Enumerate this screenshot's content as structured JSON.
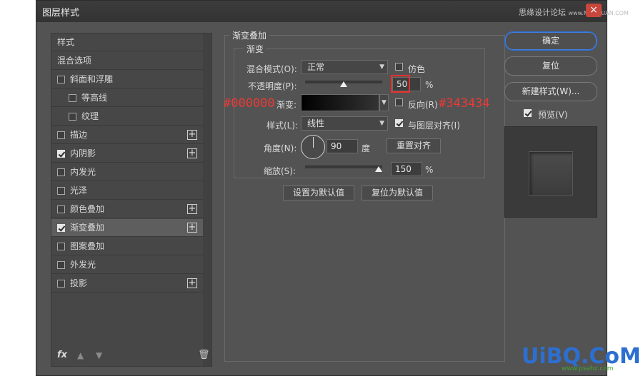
{
  "window": {
    "title": "图层样式",
    "close_label": "×",
    "watermark_text": "思缘设计论坛",
    "watermark_url": "www.MISSYUAN.COM"
  },
  "style_list": {
    "items": [
      {
        "label": "样式",
        "checkbox": null,
        "plus": false,
        "indent": 0,
        "selected": false
      },
      {
        "label": "混合选项",
        "checkbox": null,
        "plus": false,
        "indent": 0,
        "selected": false
      },
      {
        "label": "斜面和浮雕",
        "checkbox": false,
        "plus": false,
        "indent": 0,
        "selected": false
      },
      {
        "label": "等高线",
        "checkbox": false,
        "plus": false,
        "indent": 1,
        "selected": false
      },
      {
        "label": "纹理",
        "checkbox": false,
        "plus": false,
        "indent": 1,
        "selected": false
      },
      {
        "label": "描边",
        "checkbox": false,
        "plus": true,
        "indent": 0,
        "selected": false
      },
      {
        "label": "内阴影",
        "checkbox": true,
        "plus": true,
        "indent": 0,
        "selected": false
      },
      {
        "label": "内发光",
        "checkbox": false,
        "plus": false,
        "indent": 0,
        "selected": false
      },
      {
        "label": "光泽",
        "checkbox": false,
        "plus": false,
        "indent": 0,
        "selected": false
      },
      {
        "label": "颜色叠加",
        "checkbox": false,
        "plus": true,
        "indent": 0,
        "selected": false
      },
      {
        "label": "渐变叠加",
        "checkbox": true,
        "plus": true,
        "indent": 0,
        "selected": true
      },
      {
        "label": "图案叠加",
        "checkbox": false,
        "plus": false,
        "indent": 0,
        "selected": false
      },
      {
        "label": "外发光",
        "checkbox": false,
        "plus": false,
        "indent": 0,
        "selected": false
      },
      {
        "label": "投影",
        "checkbox": false,
        "plus": true,
        "indent": 0,
        "selected": false
      }
    ],
    "footer": {
      "fx": "fx",
      "up": "▲",
      "down": "▼",
      "trash": "🗑"
    }
  },
  "gradient_overlay": {
    "section_title": "渐变叠加",
    "group_title": "渐变",
    "blend_mode_label": "混合模式(O):",
    "blend_mode_value": "正常",
    "dither_label": "仿色",
    "dither_checked": false,
    "opacity_label": "不透明度(P):",
    "opacity_value": "50",
    "opacity_unit": "%",
    "opacity_level": 0.5,
    "gradient_label": "渐变:",
    "gradient_from": "#000000",
    "gradient_to": "#343434",
    "reverse_label": "反向(R)",
    "reverse_checked": false,
    "style_label": "样式(L):",
    "style_value": "线性",
    "align_label": "与图层对齐(I)",
    "align_checked": true,
    "angle_label": "角度(N):",
    "angle_value": "90",
    "angle_unit": "度",
    "reset_align_label": "重置对齐",
    "scale_label": "缩放(S):",
    "scale_value": "150",
    "scale_unit": "%",
    "scale_level": 1.0,
    "set_default_label": "设置为默认值",
    "reset_default_label": "复位为默认值"
  },
  "annotations": {
    "left_color": "#000000",
    "right_color": "#343434"
  },
  "actions": {
    "ok_label": "确定",
    "reset_label": "复位",
    "new_style_label": "新建样式(W)...",
    "preview_label": "预览(V)",
    "preview_checked": true
  },
  "logo": {
    "text": "UiBQ.CoM",
    "sub": "www.psahz.com"
  },
  "colors": {
    "dialog_bg": "#535353",
    "accent": "#2f6fd3",
    "annotation": "#ea3a36"
  }
}
